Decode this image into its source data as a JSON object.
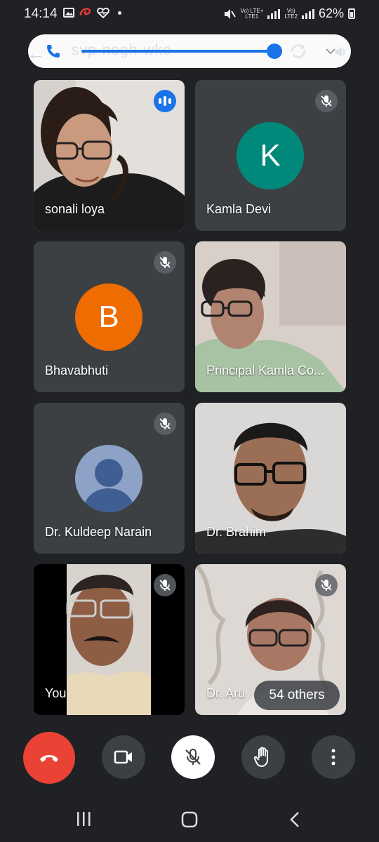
{
  "status_bar": {
    "time": "14:14",
    "battery": "62%",
    "sim1_label": "Vo) LTE+",
    "sim1_sub": "LTE1",
    "sim2_label": "Vo)",
    "sim2_sub": "LTE2"
  },
  "meeting": {
    "code": "svp-negh-wko",
    "volume_level": 0.94
  },
  "participants": [
    {
      "name": "sonali loya",
      "state": "speaking",
      "video": true
    },
    {
      "name": "Kamla Devi",
      "state": "muted",
      "initial": "K",
      "avatar_color": "#00897b"
    },
    {
      "name": "Bhavabhuti",
      "state": "muted",
      "initial": "B",
      "avatar_color": "#ef6c00"
    },
    {
      "name": "Principal Kamla Co...",
      "state": "unmuted",
      "video": true
    },
    {
      "name": "Dr. Kuldeep Narain",
      "state": "muted",
      "avatar_color": "#8ea2c8"
    },
    {
      "name": "Dr. Brahim",
      "state": "unmuted",
      "video": true
    },
    {
      "name": "You",
      "state": "muted",
      "video": true
    },
    {
      "name": "Dr. Aru",
      "state": "muted",
      "video": true
    }
  ],
  "others_label": "54 others",
  "colors": {
    "background": "#202124",
    "tile": "#3c4043",
    "accent": "#1a73e8",
    "end_call": "#ea4335"
  }
}
